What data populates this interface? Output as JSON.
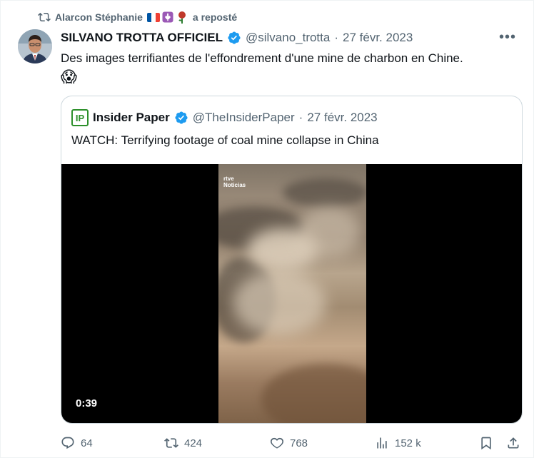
{
  "repost": {
    "reposter": "Alarcon Stéphanie",
    "suffix": "a reposté"
  },
  "tweet": {
    "author_name": "SILVANO TROTTA OFFICIEL",
    "handle": "@silvano_trotta",
    "separator": "·",
    "date": "27 févr. 2023",
    "more_label": "•••",
    "text": "Des images terrifiantes de l'effondrement d'une mine de charbon en Chine.",
    "emoji": "😱"
  },
  "quoted": {
    "logo_text": "IP",
    "author_name": "Insider Paper",
    "handle": "@TheInsiderPaper",
    "separator": "·",
    "date": "27 févr. 2023",
    "text": "WATCH: Terrifying footage of coal mine collapse in China",
    "video": {
      "watermark_line1": "rtve",
      "watermark_line2": "Noticias",
      "duration": "0:39"
    }
  },
  "actions": {
    "replies": "64",
    "reposts": "424",
    "likes": "768",
    "views": "152 k"
  },
  "colors": {
    "verified_blue": "#1d9bf0",
    "text_primary": "#0f1419",
    "text_secondary": "#536471",
    "border": "#cfd9de",
    "logo_green": "#2c8f2a"
  },
  "icons": [
    "repost-icon",
    "verified-badge-icon",
    "more-icon",
    "reply-icon",
    "like-icon",
    "views-icon",
    "bookmark-icon",
    "share-icon"
  ]
}
